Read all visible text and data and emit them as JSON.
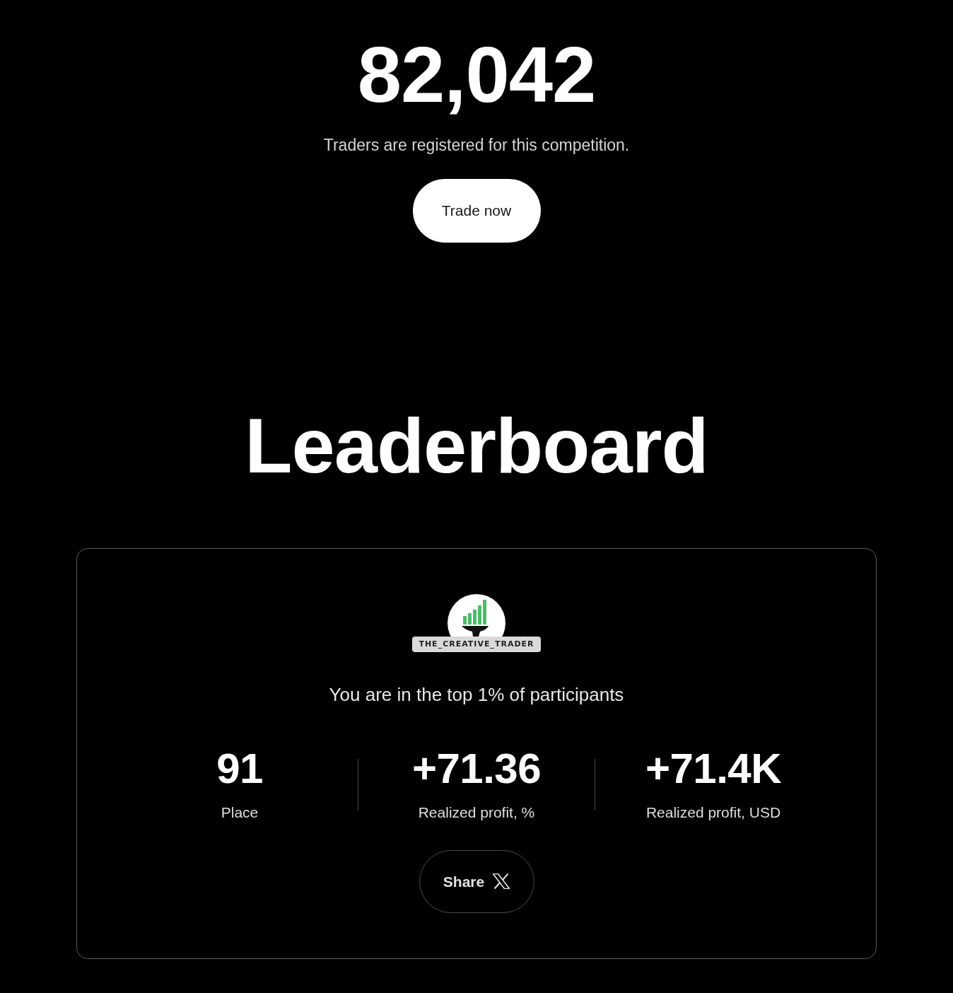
{
  "hero": {
    "count": "82,042",
    "caption": "Traders are registered for this competition.",
    "button": "Trade now"
  },
  "leaderboard": {
    "title": "Leaderboard",
    "card": {
      "username": "THE_CREATIVE_TRADER",
      "rank_text": "You are in the top 1% of participants",
      "stats": [
        {
          "value": "91",
          "label": "Place"
        },
        {
          "value": "+71.36",
          "label": "Realized profit, %"
        },
        {
          "value": "+71.4K",
          "label": "Realized profit, USD"
        }
      ],
      "share_button": "Share"
    }
  }
}
